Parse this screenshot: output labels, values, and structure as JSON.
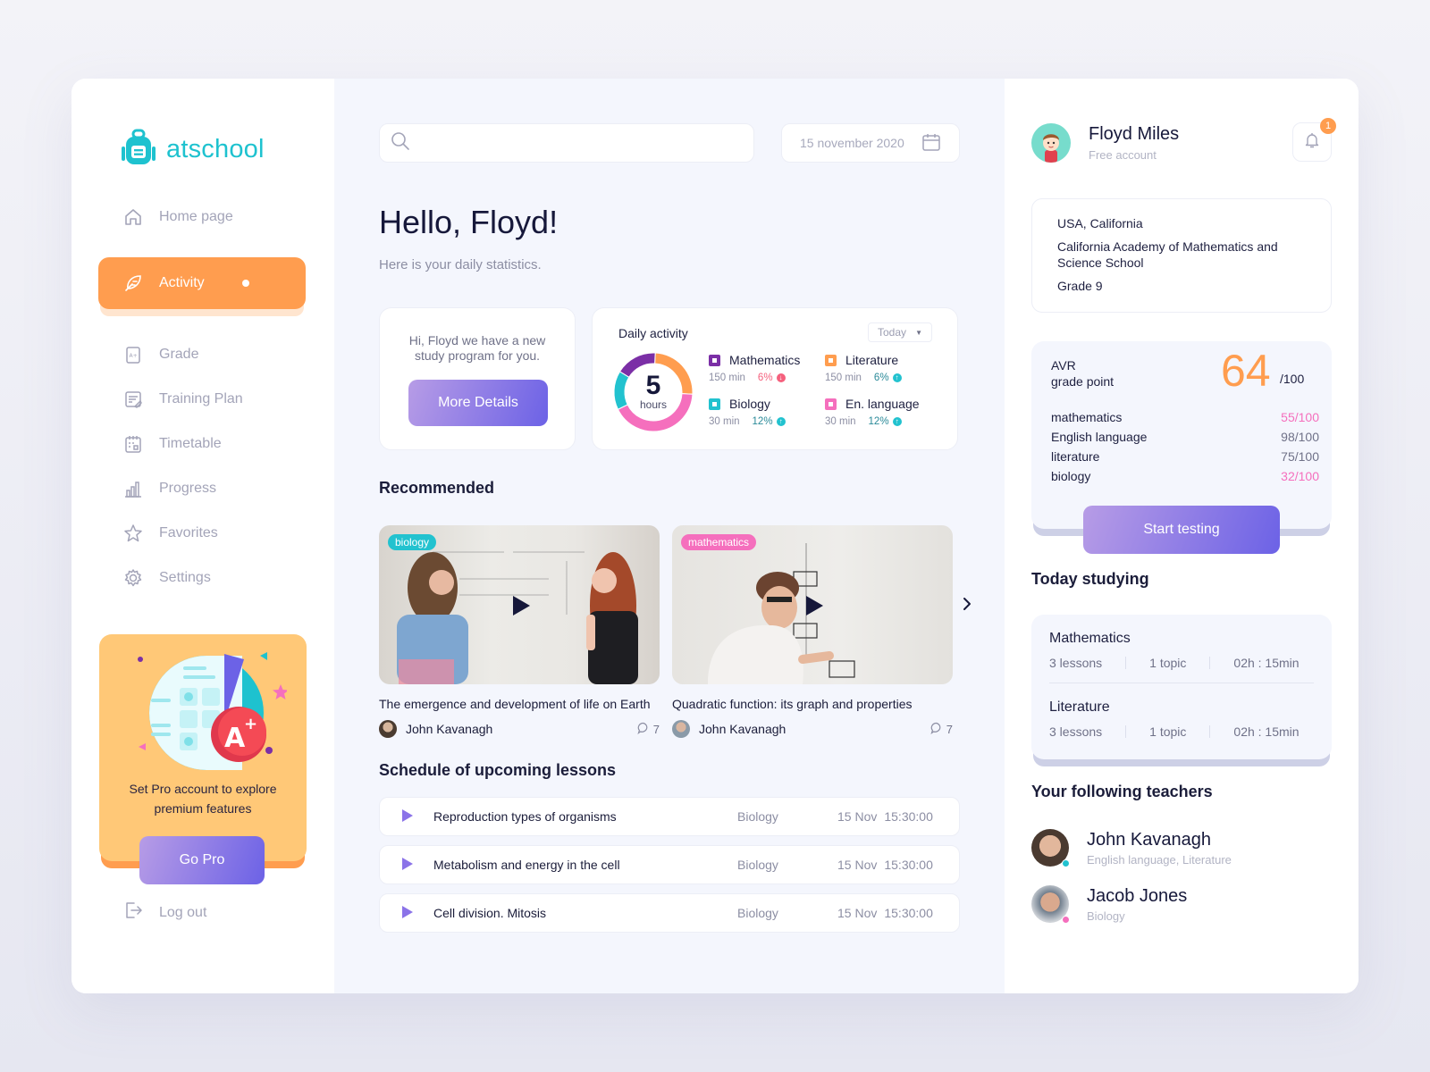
{
  "brand": {
    "name": "atschool",
    "color": "#1ec2cf"
  },
  "sidebar": {
    "items": [
      {
        "label": "Home page",
        "icon": "home-icon",
        "active": false
      },
      {
        "label": "Activity",
        "icon": "feather-icon",
        "active": true
      },
      {
        "label": "Grade",
        "icon": "grade-icon",
        "active": false
      },
      {
        "label": "Training Plan",
        "icon": "training-plan-icon",
        "active": false
      },
      {
        "label": "Timetable",
        "icon": "calendar-icon",
        "active": false
      },
      {
        "label": "Progress",
        "icon": "bar-chart-icon",
        "active": false
      },
      {
        "label": "Favorites",
        "icon": "star-icon",
        "active": false
      },
      {
        "label": "Settings",
        "icon": "gear-icon",
        "active": false
      }
    ],
    "promo": {
      "text_line1": "Set Pro account to explore",
      "text_line2": "premium features",
      "button": "Go Pro"
    },
    "logout": "Log out"
  },
  "header": {
    "search_placeholder": "",
    "date": "15 november 2020"
  },
  "greeting": {
    "title": "Hello, Floyd!",
    "subtitle": "Here is your daily statistics."
  },
  "program_card": {
    "message": "Hi, Floyd we have a new study program for you.",
    "button": "More Details"
  },
  "daily_activity": {
    "title": "Daily activity",
    "period": "Today",
    "total_value": "5",
    "total_unit": "hours",
    "subjects": [
      {
        "name": "Mathematics",
        "minutes": "150 min",
        "change": "6%",
        "trend": "down",
        "color": "#7b2fa6"
      },
      {
        "name": "Literature",
        "minutes": "150 min",
        "change": "6%",
        "trend": "up",
        "color": "#ff9d4f"
      },
      {
        "name": "Biology",
        "minutes": "30 min",
        "change": "12%",
        "trend": "up",
        "color": "#22c2cf"
      },
      {
        "name": "En. language",
        "minutes": "30 min",
        "change": "12%",
        "trend": "up",
        "color": "#f56fbd"
      }
    ],
    "donut_shares": [
      {
        "subject": "Literature",
        "fraction": 0.25,
        "color": "#ff9d4f"
      },
      {
        "subject": "En. language",
        "fraction": 0.42,
        "color": "#f56fbd"
      },
      {
        "subject": "Biology",
        "fraction": 0.16,
        "color": "#22c2cf"
      },
      {
        "subject": "Mathematics",
        "fraction": 0.17,
        "color": "#7b2fa6"
      }
    ],
    "colors": {
      "down": "#f5607d",
      "up": "#22c2cf"
    }
  },
  "recommended": {
    "title": "Recommended",
    "videos": [
      {
        "tag": "biology",
        "tag_color": "#22c2cf",
        "title": "The emergence and development of life on Earth",
        "author": "John Kavanagh",
        "comments": "7"
      },
      {
        "tag": "mathematics",
        "tag_color": "#f56fbd",
        "title": "Quadratic function: its graph and properties",
        "author": "John Kavanagh",
        "comments": "7"
      }
    ]
  },
  "schedule": {
    "title": "Schedule of upcoming lessons",
    "lessons": [
      {
        "name": "Reproduction types of organisms",
        "subject": "Biology",
        "date": "15 Nov",
        "time": "15:30:00"
      },
      {
        "name": "Metabolism and energy in the cell",
        "subject": "Biology",
        "date": "15 Nov",
        "time": "15:30:00"
      },
      {
        "name": "Cell division. Mitosis",
        "subject": "Biology",
        "date": "15 Nov",
        "time": "15:30:00"
      }
    ]
  },
  "profile": {
    "name": "Floyd Miles",
    "account": "Free account",
    "notifications": "1",
    "location": "USA, California",
    "school": "California Academy of Mathematics and Science School",
    "grade": "Grade 9"
  },
  "gpa": {
    "label_line1": "AVR",
    "label_line2": "grade point",
    "value": "64",
    "out_of": "/100",
    "grades": [
      {
        "subject": "mathematics",
        "score": "55/100",
        "low": true
      },
      {
        "subject": "English language",
        "score": "98/100",
        "low": false
      },
      {
        "subject": "literature",
        "score": "75/100",
        "low": false
      },
      {
        "subject": "biology",
        "score": "32/100",
        "low": true
      }
    ],
    "low_color": "#f56fbd",
    "button": "Start testing"
  },
  "today_studying": {
    "title": "Today studying",
    "items": [
      {
        "subject": "Mathematics",
        "lessons": "3 lessons",
        "topics": "1 topic",
        "duration": "02h : 15min"
      },
      {
        "subject": "Literature",
        "lessons": "3 lessons",
        "topics": "1 topic",
        "duration": "02h : 15min"
      }
    ]
  },
  "teachers": {
    "title": "Your following teachers",
    "list": [
      {
        "name": "John Kavanagh",
        "subjects": "English language, Literature",
        "status_color": "#22c2cf"
      },
      {
        "name": "Jacob Jones",
        "subjects": "Biology",
        "status_color": "#f56fbd"
      }
    ]
  }
}
